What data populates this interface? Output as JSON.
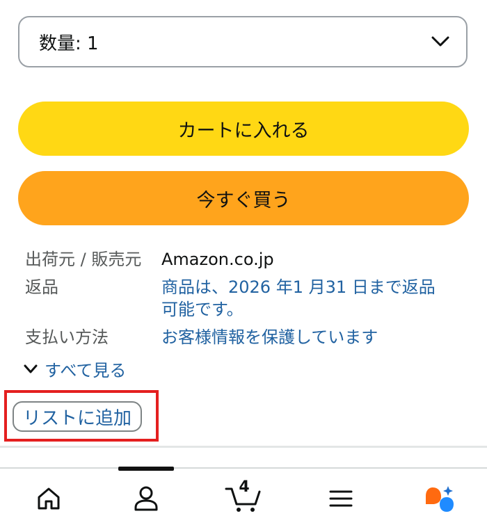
{
  "quantity": {
    "label": "数量: 1",
    "icon": "chevron-down-icon"
  },
  "actions": {
    "add_to_cart": "カートに入れる",
    "buy_now": "今すぐ買う",
    "add_to_list": "リストに追加"
  },
  "details": {
    "seller_label": "出荷元 / 販売元",
    "seller_value": "Amazon.co.jp",
    "returns_label": "返品",
    "returns_value_line1": "商品は、2026 年1 月31 日まで返品",
    "returns_value_line2": "可能です。",
    "payment_label": "支払い方法",
    "payment_value": "お客様情報を保護しています",
    "see_all": "すべて見る"
  },
  "bottom_nav": {
    "cart_count": "4",
    "items": [
      "home-icon",
      "account-icon",
      "cart-icon",
      "menu-icon",
      "rufus-icon"
    ]
  },
  "colors": {
    "cart_button": "#ffd814",
    "buy_button": "#ffa41c",
    "link": "#2162a1",
    "highlight": "#e41f1f"
  }
}
